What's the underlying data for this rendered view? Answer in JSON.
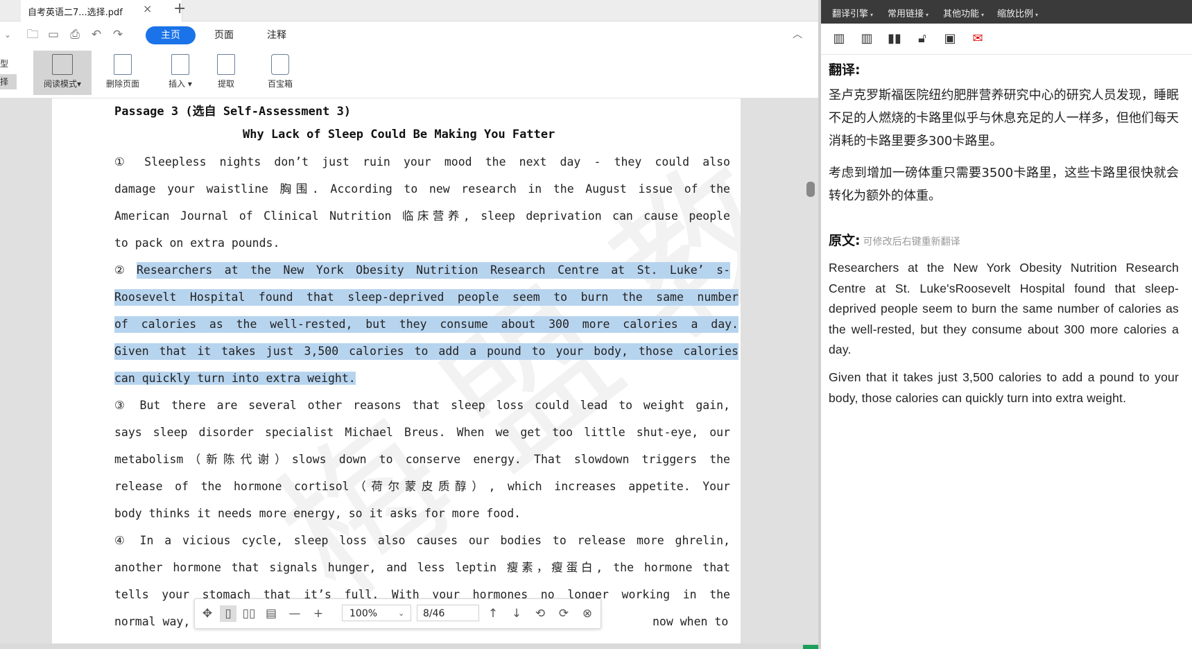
{
  "tab": {
    "title": "自考英语二7...选择.pdf",
    "close": "×",
    "new": "+"
  },
  "ribbon_tabs": [
    "主页",
    "页面",
    "注释"
  ],
  "side_stub": [
    "型",
    "择"
  ],
  "ribbon_buttons": [
    {
      "label": "阅读模式"
    },
    {
      "label": "删除页面"
    },
    {
      "label": "插入"
    },
    {
      "label": "提取"
    },
    {
      "label": "百宝箱"
    }
  ],
  "document": {
    "passage_title": "Passage 3 (选自 Self-Assessment 3)",
    "article_title": "Why Lack of Sleep Could Be Making You Fatter",
    "lines": [
      "① Sleepless nights don’t just ruin your mood the next day - they could also",
      "damage your waistline 胸围. According to new research in the August issue of the",
      "American Journal of Clinical Nutrition 临床营养, sleep deprivation can cause people",
      "to pack on extra pounds.",
      "Researchers at the New York Obesity Nutrition Research Centre at St. Luke’ s-",
      "Roosevelt Hospital found that sleep-deprived people seem to burn the same number",
      "of calories as the well-rested, but they consume about 300 more calories a day.",
      "Given that it takes just 3,500 calories to add a pound to your body, those calories",
      "can quickly turn into extra weight.",
      "③ But there are several other reasons that sleep loss could lead to weight gain,",
      "says sleep disorder specialist Michael Breus. When we get too little shut-eye, our",
      "metabolism（新陈代谢）slows down to conserve energy. That slowdown triggers the",
      "release of the hormone cortisol（荷尔蒙皮质醇）, which increases appetite. Your",
      "body thinks it needs more energy, so it asks for more food.",
      "④ In a vicious cycle, sleep loss also causes our bodies to release more ghrelin,",
      "another hormone that signals hunger, and less leptin 瘦素，瘦蛋白, the hormone that",
      "tells your stomach that it’s full. With your hormones no longer working in the",
      "normal way,",
      "now when to"
    ],
    "para2_marker": "②"
  },
  "viewer": {
    "zoom": "100%",
    "page": "8/46"
  },
  "translator": {
    "menus": [
      "翻译引擎",
      "常用链接",
      "其他功能",
      "缩放比例"
    ],
    "translation_heading": "翻译:",
    "translation_paragraphs": [
      "圣卢克罗斯福医院纽约肥胖营养研究中心的研究人员发现，睡眠不足的人燃烧的卡路里似乎与休息充足的人一样多，但他们每天消耗的卡路里要多300卡路里。",
      "考虑到增加一磅体重只需要3500卡路里，这些卡路里很快就会转化为额外的体重。"
    ],
    "source_heading": "原文:",
    "source_hint": "可修改后右键重新翻译",
    "source_paragraphs": [
      "Researchers at the New York Obesity Nutrition Research Centre at St. Luke'sRoosevelt Hospital found that sleep-deprived people seem to burn the same number of calories as the well-rested, but they consume about 300 more calories a day.",
      "Given that it takes just 3,500 calories to add a pound to your body, those calories can quickly turn into extra weight."
    ]
  },
  "colors": {
    "accent": "#1a73e8",
    "highlight": "#b7d4ef",
    "mail": "#dd1111"
  }
}
